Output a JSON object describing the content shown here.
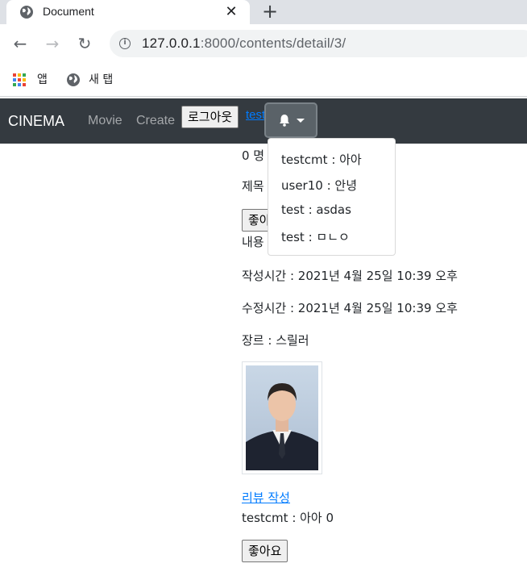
{
  "browser": {
    "tab_title": "Document",
    "close_glyph": "✕",
    "new_tab_glyph": "+",
    "url_host": "127.0.0.1",
    "url_rest": ":8000/contents/detail/3/",
    "bookmarks": [
      {
        "label": "앱",
        "icon": "apps-grid-icon"
      },
      {
        "label": "새 탭",
        "icon": "globe-icon"
      }
    ]
  },
  "navbar": {
    "brand": "CINEMA",
    "links": [
      "Movie",
      "Create"
    ],
    "logout_label": "로그아웃",
    "user_link": "test"
  },
  "notifications": [
    "testcmt : 아아",
    "user10 : 안녕",
    "test : asdas",
    "test : ㅁㄴㅇ"
  ],
  "content": {
    "likes_prefix": "0 명",
    "title_prefix": "제목",
    "like_button_partial": "좋아",
    "content_prefix": "내용",
    "created": "작성시간 : 2021년 4월 25일 10:39 오후",
    "updated": "수정시간 : 2021년 4월 25일 10:39 오후",
    "genre": "장르 : 스릴러",
    "review_link": "리뷰 작성",
    "comment": "testcmt : 아아 0",
    "like_button": "좋아요"
  },
  "colors": {
    "navbar_bg": "#343a40",
    "link": "#007bff"
  }
}
